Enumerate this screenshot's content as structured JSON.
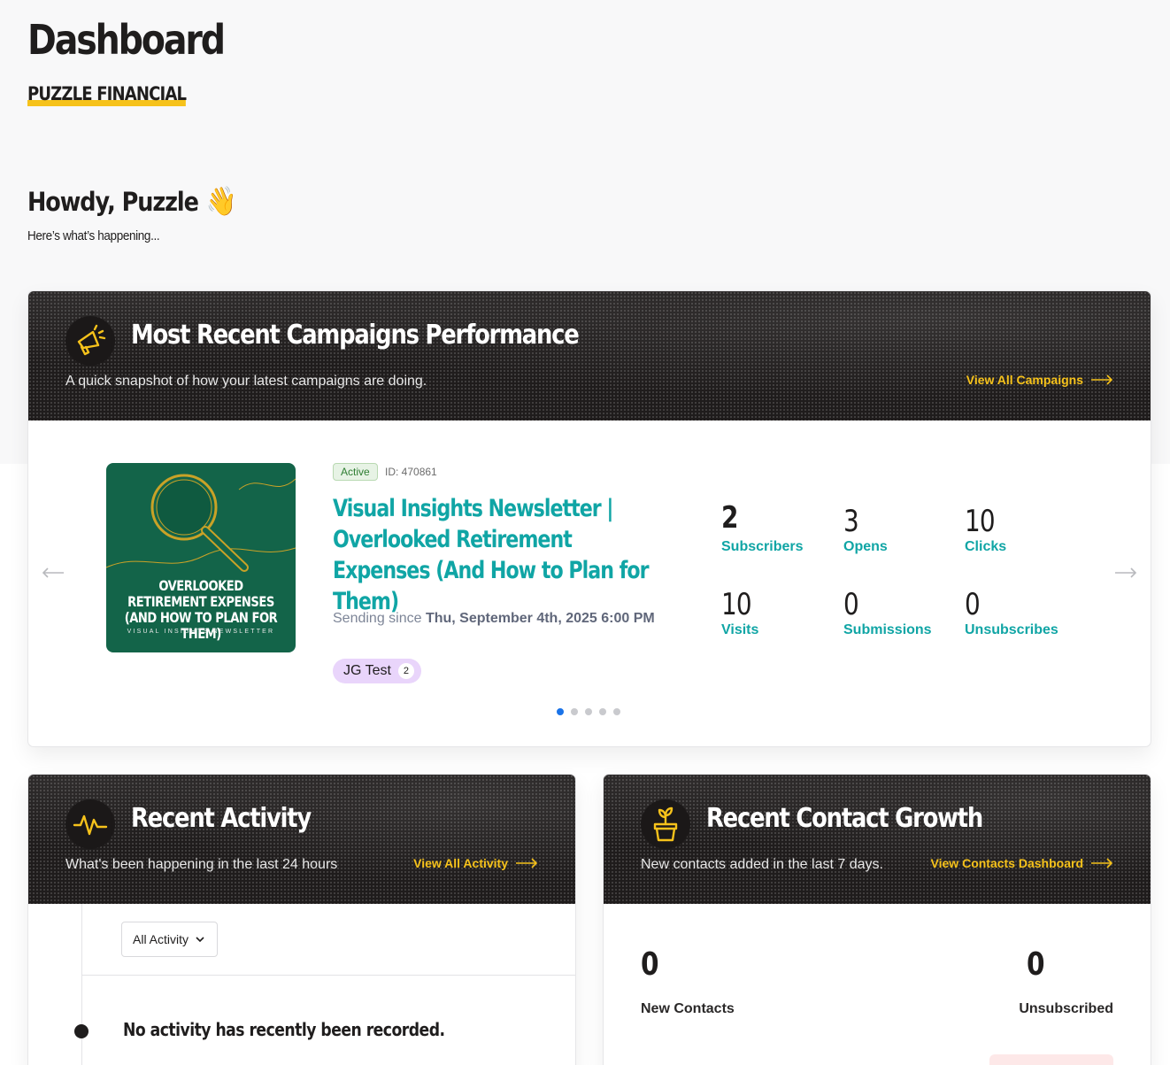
{
  "page": {
    "title": "Dashboard",
    "org_name": "PUZZLE FINANCIAL",
    "greeting": "Howdy, Puzzle",
    "greeting_emoji": "👋",
    "subgreeting": "Here’s what’s happening..."
  },
  "campaigns": {
    "title": "Most Recent Campaigns Performance",
    "subtitle": "A quick snapshot of how your latest campaigns are doing.",
    "link_label": "View All Campaigns",
    "header_icon": "megaphone-icon",
    "current": {
      "status": "Active",
      "id_label": "ID: 470861",
      "title": "Visual Insights Newsletter | Overlooked Retirement Expenses (And How to Plan for Them)",
      "sending_prefix": "Sending since",
      "sending_date": "Thu, September 4th, 2025 6:00 PM",
      "tag_label": "JG Test",
      "tag_count": "2",
      "thumbnail": {
        "line1": "OVERLOOKED",
        "line2": "RETIREMENT EXPENSES",
        "line3": "(AND HOW TO PLAN FOR THEM)",
        "small": "VISUAL INSIGHTS NEWSLETTER",
        "bg_color": "#136449",
        "accent_color": "#c9a227"
      },
      "stats": [
        {
          "value": "2",
          "label": "Subscribers"
        },
        {
          "value": "3",
          "label": "Opens"
        },
        {
          "value": "10",
          "label": "Clicks"
        },
        {
          "value": "10",
          "label": "Visits"
        },
        {
          "value": "0",
          "label": "Submissions"
        },
        {
          "value": "0",
          "label": "Unsubscribes"
        }
      ]
    },
    "slide_count": 5,
    "active_slide": 1
  },
  "activity": {
    "title": "Recent Activity",
    "subtitle": "What's been happening in the last 24 hours",
    "link_label": "View All Activity",
    "header_icon": "activity-pulse-icon",
    "filter_value": "All Activity",
    "empty_message": "No activity has recently been recorded."
  },
  "growth": {
    "title": "Recent Contact Growth",
    "subtitle": "New contacts added in the last 7 days.",
    "link_label": "View Contacts Dashboard",
    "header_icon": "plant-pot-icon",
    "new_contacts_value": "0",
    "new_contacts_label": "New Contacts",
    "unsubscribed_value": "0",
    "unsubscribed_label": "Unsubscribed"
  },
  "colors": {
    "accent_yellow": "#f6c21b",
    "teal": "#10a5a5",
    "header_dark": "#1f1c1c",
    "active_dot": "#1a73e8",
    "tag_bg": "#e9d5fb"
  }
}
